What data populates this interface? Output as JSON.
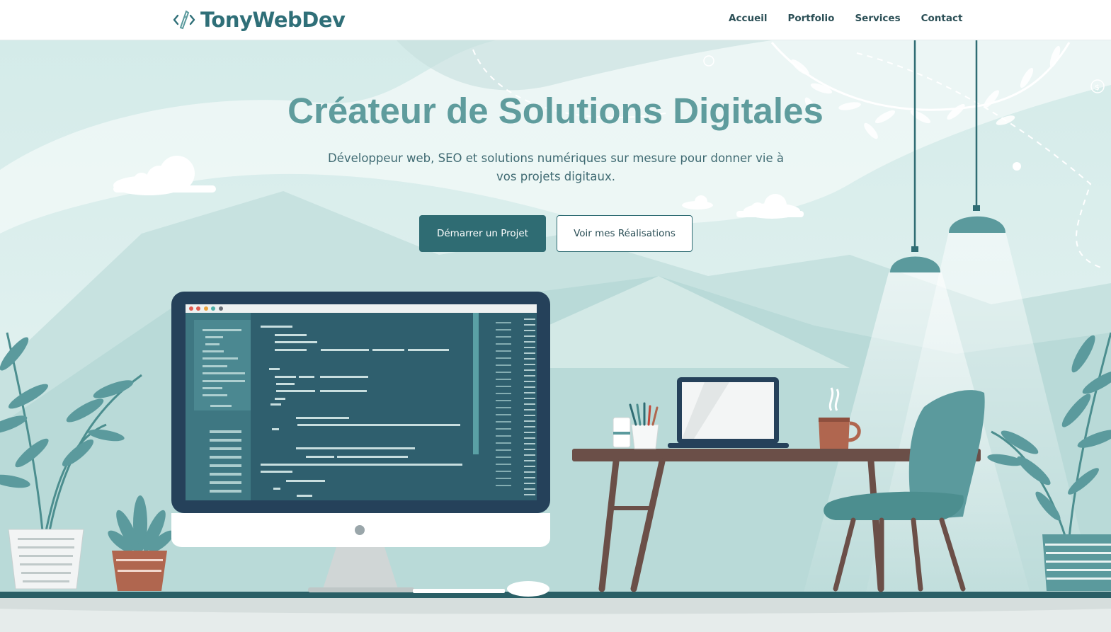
{
  "brand": {
    "name": "TonyWebDev",
    "icon": "code-pen-icon"
  },
  "nav": {
    "items": [
      {
        "label": "Accueil"
      },
      {
        "label": "Portfolio"
      },
      {
        "label": "Services"
      },
      {
        "label": "Contact"
      }
    ]
  },
  "hero": {
    "title": "Créateur de Solutions Digitales",
    "subtitle": "Développeur web, SEO et solutions numériques sur mesure pour donner vie à vos projets digitaux.",
    "primary_button": "Démarrer un Projet",
    "secondary_button": "Voir mes Réalisations",
    "illustration": "workspace-illustration"
  },
  "colors": {
    "accent": "#2f6c73",
    "title": "#5f9c9d",
    "background_light": "#e2f0ef",
    "teal_mid": "#5b9a9d"
  }
}
